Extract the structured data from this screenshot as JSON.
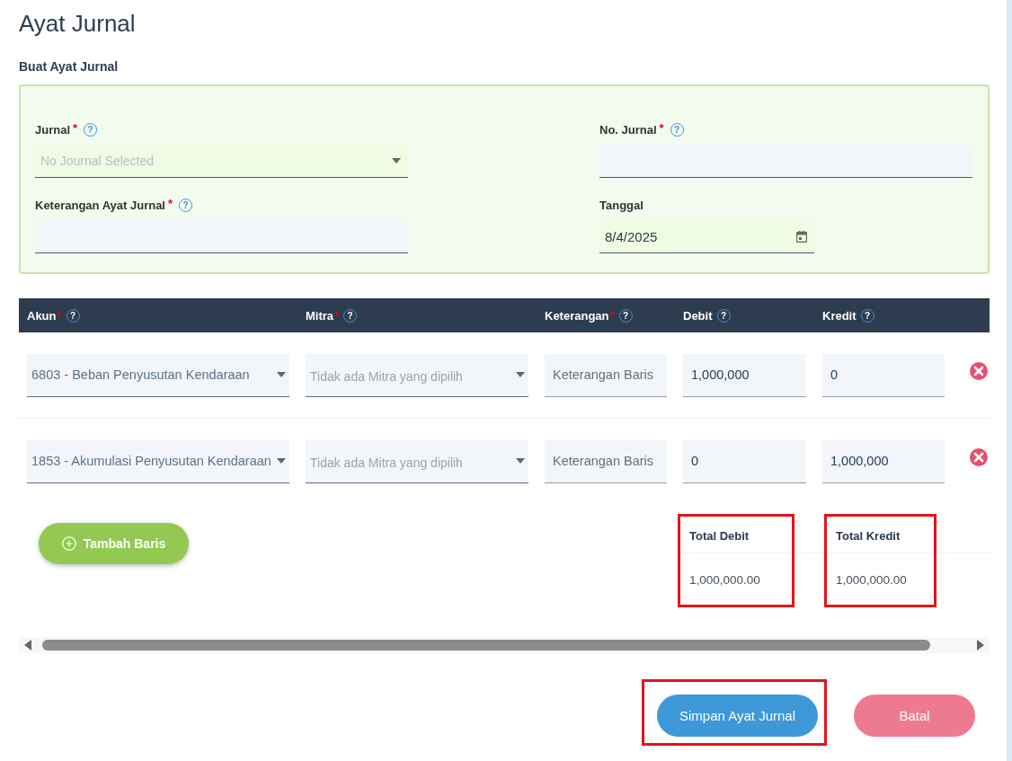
{
  "page": {
    "title": "Ayat Jurnal",
    "section": "Buat Ayat Jurnal"
  },
  "form": {
    "fields": [
      {
        "label": "Jurnal",
        "required_mark": "*",
        "help": "?",
        "kind": "select",
        "placeholder": "No Journal Selected"
      },
      {
        "label": "No. Jurnal",
        "required_mark": "*",
        "help": "?",
        "kind": "text"
      },
      {
        "label": "Keterangan Ayat Jurnal",
        "required_mark": "*",
        "help": "?",
        "kind": "text"
      },
      {
        "label": "Tanggal",
        "kind": "date",
        "value": "8/4/2025"
      }
    ]
  },
  "table": {
    "columns": [
      {
        "label": "Akun",
        "required_mark": "*",
        "help": "?"
      },
      {
        "label": "Mitra",
        "required_mark": "*",
        "help": "?"
      },
      {
        "label": "Keterangan",
        "required_mark": "*",
        "help": "?"
      },
      {
        "label": "Debit",
        "help": "?"
      },
      {
        "label": "Kredit",
        "help": "?"
      }
    ],
    "rows": [
      {
        "akun": "6803 - Beban Penyusutan Kendaraan",
        "mitra_placeholder": "Tidak ada Mitra yang dipilih",
        "keterangan_placeholder": "Keterangan Baris",
        "debit": "1,000,000",
        "kredit": "0"
      },
      {
        "akun": "1853 - Akumulasi Penyusutan Kendaraan",
        "mitra_placeholder": "Tidak ada Mitra yang dipilih",
        "keterangan_placeholder": "Keterangan Baris",
        "debit": "0",
        "kredit": "1,000,000"
      }
    ]
  },
  "add_row_button": {
    "label": "Tambah Baris"
  },
  "totals": [
    {
      "label": "Total Debit",
      "value": "1,000,000.00",
      "highlighted": true
    },
    {
      "label": "Total Kredit",
      "value": "1,000,000.00",
      "highlighted": true
    }
  ],
  "buttons": [
    {
      "label": "Simpan Ayat Jurnal",
      "kind": "primary",
      "highlighted": true
    },
    {
      "label": "Batal",
      "kind": "danger",
      "highlighted": false
    }
  ]
}
